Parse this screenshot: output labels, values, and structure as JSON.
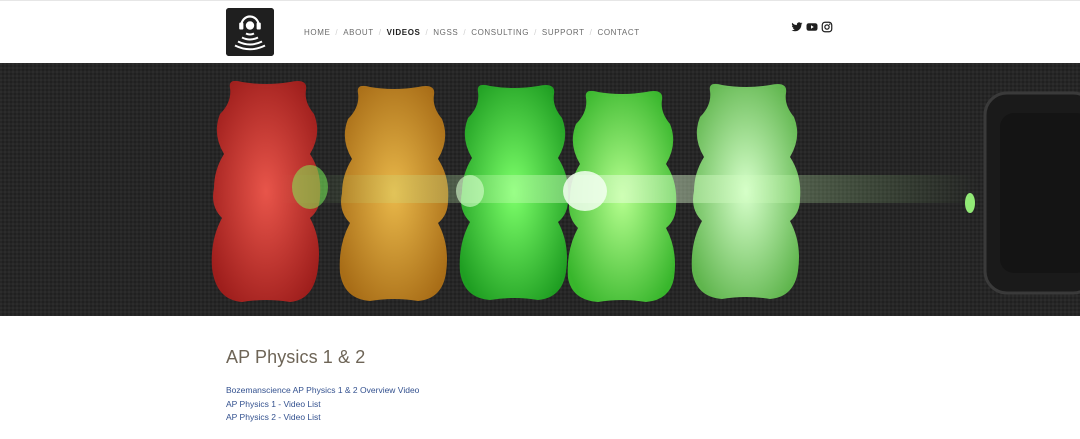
{
  "header": {
    "logo_icon": "headphones-sound-waves-logo-icon",
    "nav": [
      {
        "label": "HOME",
        "active": false
      },
      {
        "label": "ABOUT",
        "active": false
      },
      {
        "label": "VIDEOS",
        "active": true
      },
      {
        "label": "NGSS",
        "active": false
      },
      {
        "label": "CONSULTING",
        "active": false
      },
      {
        "label": "SUPPORT",
        "active": false
      },
      {
        "label": "CONTACT",
        "active": false
      }
    ],
    "nav_separator": "/",
    "social": [
      "twitter-icon",
      "youtube-icon",
      "instagram-icon"
    ]
  },
  "hero": {
    "image": "gummy-bears-laser-photo",
    "bear_colors": [
      "#c8312c",
      "#d39a2a",
      "#3fd63a",
      "#5cea3e",
      "#8ee07c"
    ]
  },
  "main": {
    "title": "AP Physics 1 & 2",
    "links": [
      "Bozemanscience AP Physics 1 & 2 Overview Video",
      "AP Physics 1 - Video List",
      "AP Physics 2 - Video List"
    ]
  },
  "colors": {
    "title": "#6e6557",
    "link": "#33518f",
    "nav_active": "#1f1f1f",
    "nav": "#6b6b6b"
  }
}
